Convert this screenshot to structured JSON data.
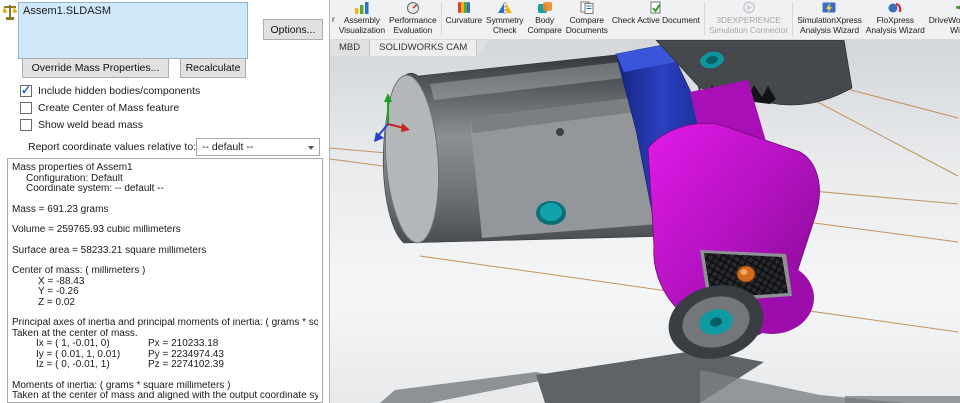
{
  "dialog": {
    "selection_value": "Assem1.SLDASM",
    "options_button": "Options...",
    "override_button": "Override Mass Properties...",
    "recalculate_button": "Recalculate",
    "checkboxes": [
      {
        "label": "Include hidden bodies/components",
        "checked": true
      },
      {
        "label": "Create Center of Mass feature",
        "checked": false
      },
      {
        "label": "Show weld bead mass",
        "checked": false
      }
    ],
    "coordinate_label": "Report coordinate values relative to:",
    "coordinate_value": "-- default --",
    "report": {
      "title": "Mass properties of Assem1",
      "configuration": "Configuration: Default",
      "coordinate_system": "Coordinate system: -- default --",
      "mass": "Mass = 691.23 grams",
      "volume": "Volume = 259765.93 cubic millimeters",
      "surface_area": "Surface area = 58233.21  square millimeters",
      "com_header": "Center of mass: ( millimeters )",
      "com_x": "X = -88.43",
      "com_y": "Y = -0.26",
      "com_z": "Z = 0.02",
      "principal_header": "Principal axes of inertia and principal moments of inertia: ( grams *  square millimeters",
      "principal_sub": "Taken at the center of mass.",
      "ix": "Ix = ( 1, -0.01,  0)",
      "px": "Px = 210233.18",
      "iy": "Iy = ( 0.01,  1,  0.01)",
      "py": "Py = 2234974.43",
      "iz": "Iz = ( 0, -0.01,  1)",
      "pz": "Pz = 2274102.39",
      "moments_header": "Moments of inertia: ( grams *  square millimeters )",
      "moments_sub": "Taken at the center of mass and aligned with the output coordinate system. (Using pos"
    }
  },
  "toolbar": {
    "items": [
      {
        "line1": "r",
        "line2": "",
        "disabled": false
      },
      {
        "line1": "Assembly",
        "line2": "Visualization",
        "disabled": false
      },
      {
        "line1": "Performance",
        "line2": "Evaluation",
        "disabled": false
      },
      {
        "line1": "Curvature",
        "line2": "",
        "disabled": false
      },
      {
        "line1": "Symmetry",
        "line2": "Check",
        "disabled": false
      },
      {
        "line1": "Body",
        "line2": "Compare",
        "disabled": false
      },
      {
        "line1": "Compare",
        "line2": "Documents",
        "disabled": false
      },
      {
        "line1": "Check Active Document",
        "line2": "",
        "disabled": false
      },
      {
        "line1": "3DEXPERIENCE",
        "line2": "Simulation Connector",
        "disabled": true
      },
      {
        "line1": "SimulationXpress",
        "line2": "Analysis Wizard",
        "disabled": false
      },
      {
        "line1": "FloXpress",
        "line2": "Analysis Wizard",
        "disabled": false
      },
      {
        "line1": "DriveWorksXpress",
        "line2": "Wizard",
        "disabled": false
      }
    ]
  },
  "tabs": {
    "mbd": "MBD",
    "cam": "SOLIDWORKS CAM"
  },
  "colors": {
    "selection_fill": "#cfe9fb",
    "model_highlight_magenta": "#c013cc",
    "feature_teal": "#0e9aa2",
    "selected_edge_orange": "#c2935c",
    "link_blue": "#2a41c0"
  }
}
